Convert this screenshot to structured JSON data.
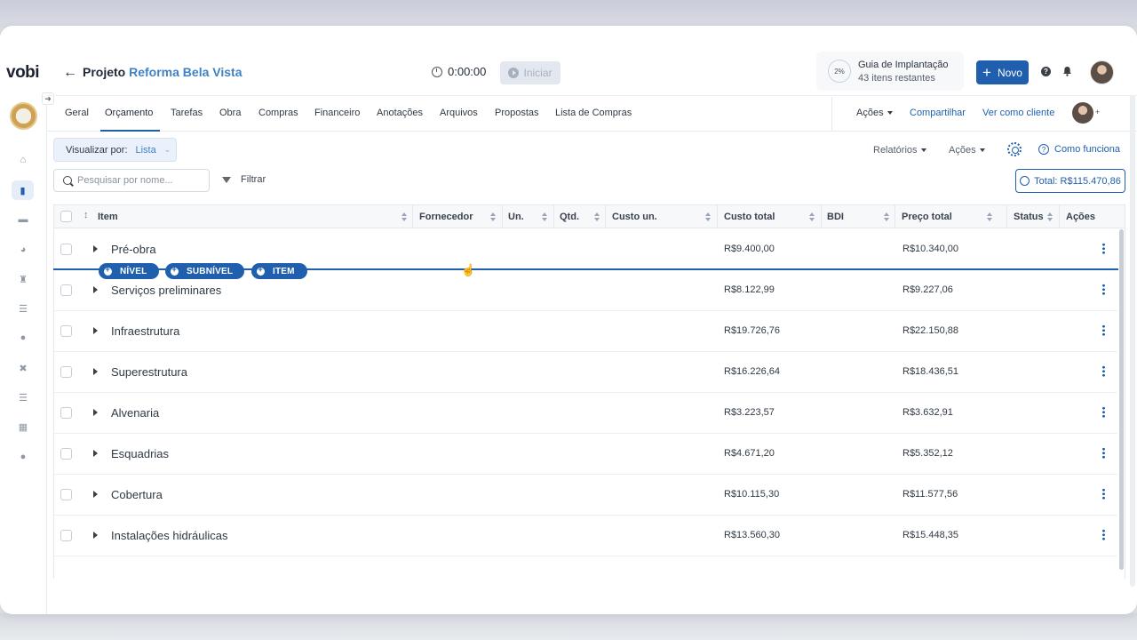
{
  "app": {
    "logo": "vobi"
  },
  "header": {
    "back_icon": "arrow-left-icon",
    "project_prefix": "Projeto",
    "project_name": "Reforma Bela Vista",
    "timer": "0:00:00",
    "start_label": "Iniciar",
    "guide": {
      "percent": "2%",
      "title": "Guia de Implantação",
      "subtitle": "43 itens restantes"
    },
    "new_label": "Novo"
  },
  "tabs": [
    "Geral",
    "Orçamento",
    "Tarefas",
    "Obra",
    "Compras",
    "Financeiro",
    "Anotações",
    "Arquivos",
    "Propostas",
    "Lista de Compras"
  ],
  "active_tab": "Orçamento",
  "tab_actions": {
    "acoes": "Ações",
    "share": "Compartilhar",
    "client_view": "Ver como cliente",
    "plus": "+"
  },
  "toolbar": {
    "view_label": "Visualizar por:",
    "view_value": "Lista",
    "reports": "Relatórios",
    "actions": "Ações",
    "how_it_works": "Como funciona",
    "search_placeholder": "Pesquisar por nome...",
    "filter": "Filtrar",
    "total": "Total: R$115.470,86"
  },
  "table": {
    "columns": [
      "Item",
      "Fornecedor",
      "Un.",
      "Qtd.",
      "Custo un.",
      "Custo total",
      "BDI",
      "Preço total",
      "Status",
      "Ações"
    ],
    "rows": [
      {
        "name": "Pré-obra",
        "custo_total": "R$9.400,00",
        "preco_total": "R$10.340,00"
      },
      {
        "name": "Serviços preliminares",
        "custo_total": "R$8.122,99",
        "preco_total": "R$9.227,06"
      },
      {
        "name": "Infraestrutura",
        "custo_total": "R$19.726,76",
        "preco_total": "R$22.150,88"
      },
      {
        "name": "Superestrutura",
        "custo_total": "R$16.226,64",
        "preco_total": "R$18.436,51"
      },
      {
        "name": "Alvenaria",
        "custo_total": "R$3.223,57",
        "preco_total": "R$3.632,91"
      },
      {
        "name": "Esquadrias",
        "custo_total": "R$4.671,20",
        "preco_total": "R$5.352,12"
      },
      {
        "name": "Cobertura",
        "custo_total": "R$10.115,30",
        "preco_total": "R$11.577,56"
      },
      {
        "name": "Instalações hidráulicas",
        "custo_total": "R$13.560,30",
        "preco_total": "R$15.448,35"
      }
    ]
  },
  "insert_bar": {
    "nivel": "NÍVEL",
    "subnivel": "SUBNÍVEL",
    "item": "ITEM"
  },
  "sidebar_icons": [
    "home-icon",
    "folder-icon",
    "handshake-icon",
    "gauge-icon",
    "worker-icon",
    "coins-icon",
    "dollar-icon",
    "tools-icon",
    "list-icon",
    "apps-icon",
    "team-icon"
  ],
  "colors": {
    "primary": "#1f5fae",
    "link": "#3f82c4"
  }
}
